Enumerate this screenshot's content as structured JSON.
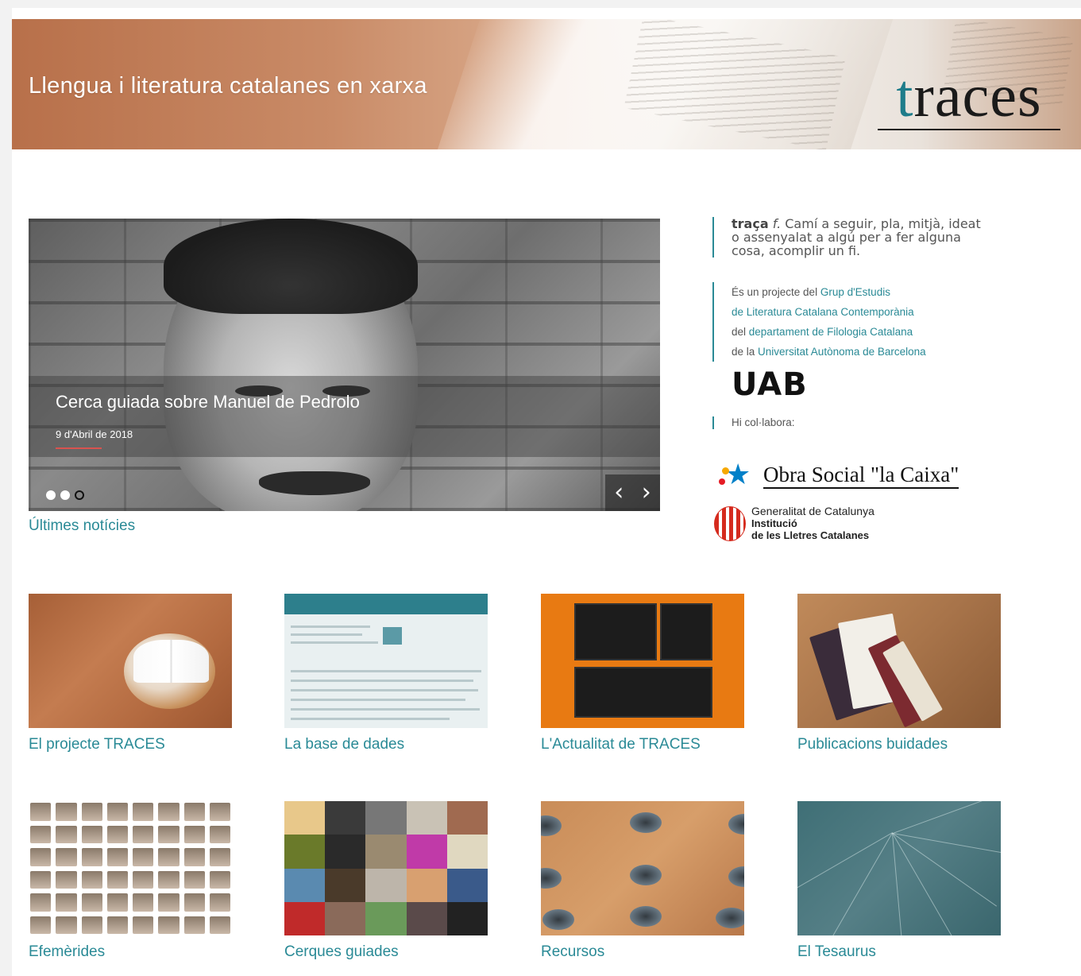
{
  "header": {
    "title": "Llengua i literatura catalanes en xarxa",
    "logo": "traces",
    "logo_first_letter": "t",
    "logo_rest": "races"
  },
  "slider": {
    "title": "Cerca guiada sobre Manuel de Pedrolo",
    "date": "9 d'Abril de 2018",
    "prev": "‹",
    "next": "›",
    "dots": 3,
    "active_dot": 1
  },
  "latest_news": "Últimes notícies",
  "definition": {
    "term": "traça",
    "pos": "f.",
    "text": "Camí a seguir, pla, mitjà, ideat o assenyalat a algú per a fer alguna cosa, acomplir un fi."
  },
  "project": {
    "l1_pre": "És un projecte del ",
    "l1_link": "Grup d'Estudis",
    "l2_link": "de Literatura Catalana Contemporània",
    "l3_pre": "del ",
    "l3_link": "departament de Filologia Catalana",
    "l4_pre": "de la ",
    "l4_link": "Universitat Autònoma de Barcelona"
  },
  "uab_logo": "UAB",
  "collab_label": "Hi col·labora:",
  "sponsors": {
    "caixa": "Obra Social \"la Caixa\"",
    "gencat_line1": "Generalitat de Catalunya",
    "gencat_line2": "Institució",
    "gencat_line3": "de les Lletres Catalanes"
  },
  "tiles": [
    {
      "label": "El projecte TRACES"
    },
    {
      "label": "La base de dades"
    },
    {
      "label": "L'Actualitat de TRACES"
    },
    {
      "label": "Publicacions buidades"
    },
    {
      "label": "Efemèrides"
    },
    {
      "label": "Cerques guiades"
    },
    {
      "label": "Recursos"
    },
    {
      "label": "El Tesaurus"
    }
  ],
  "colors": {
    "accent": "#2a8a96",
    "banner": "#b8704a",
    "caixa_blue": "#0080c8"
  }
}
